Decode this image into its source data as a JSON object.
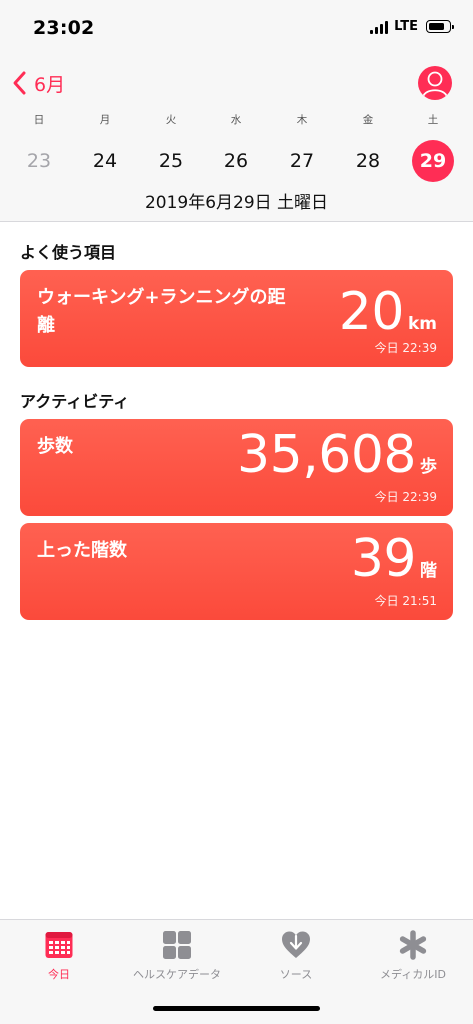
{
  "status_bar": {
    "time": "23:02",
    "network": "LTE"
  },
  "header": {
    "back_label": "6月",
    "weekdays": [
      "日",
      "月",
      "火",
      "水",
      "木",
      "金",
      "土"
    ],
    "days": [
      "23",
      "24",
      "25",
      "26",
      "27",
      "28",
      "29"
    ],
    "selected_day": "29",
    "full_date": "2019年6月29日 土曜日"
  },
  "favorites": {
    "title": "よく使う項目",
    "cards": [
      {
        "label": "ウォーキング+ランニングの距離",
        "value": "20",
        "unit": "km",
        "time": "今日 22:39"
      }
    ]
  },
  "activity": {
    "title": "アクティビティ",
    "cards": [
      {
        "label": "歩数",
        "value": "35,608",
        "unit": "歩",
        "time": "今日 22:39"
      },
      {
        "label": "上った階数",
        "value": "39",
        "unit": "階",
        "time": "今日 21:51"
      }
    ]
  },
  "tabbar": {
    "tabs": [
      {
        "label": "今日",
        "icon": "calendar-icon",
        "active": true
      },
      {
        "label": "ヘルスケアデータ",
        "icon": "grid-icon",
        "active": false
      },
      {
        "label": "ソース",
        "icon": "heart-download-icon",
        "active": false
      },
      {
        "label": "メディカルID",
        "icon": "asterisk-icon",
        "active": false
      }
    ]
  },
  "colors": {
    "accent": "#ff2d55",
    "card": "#fb4a3b",
    "bar_bg": "#f7f7f7",
    "inactive": "#8e8e93"
  }
}
